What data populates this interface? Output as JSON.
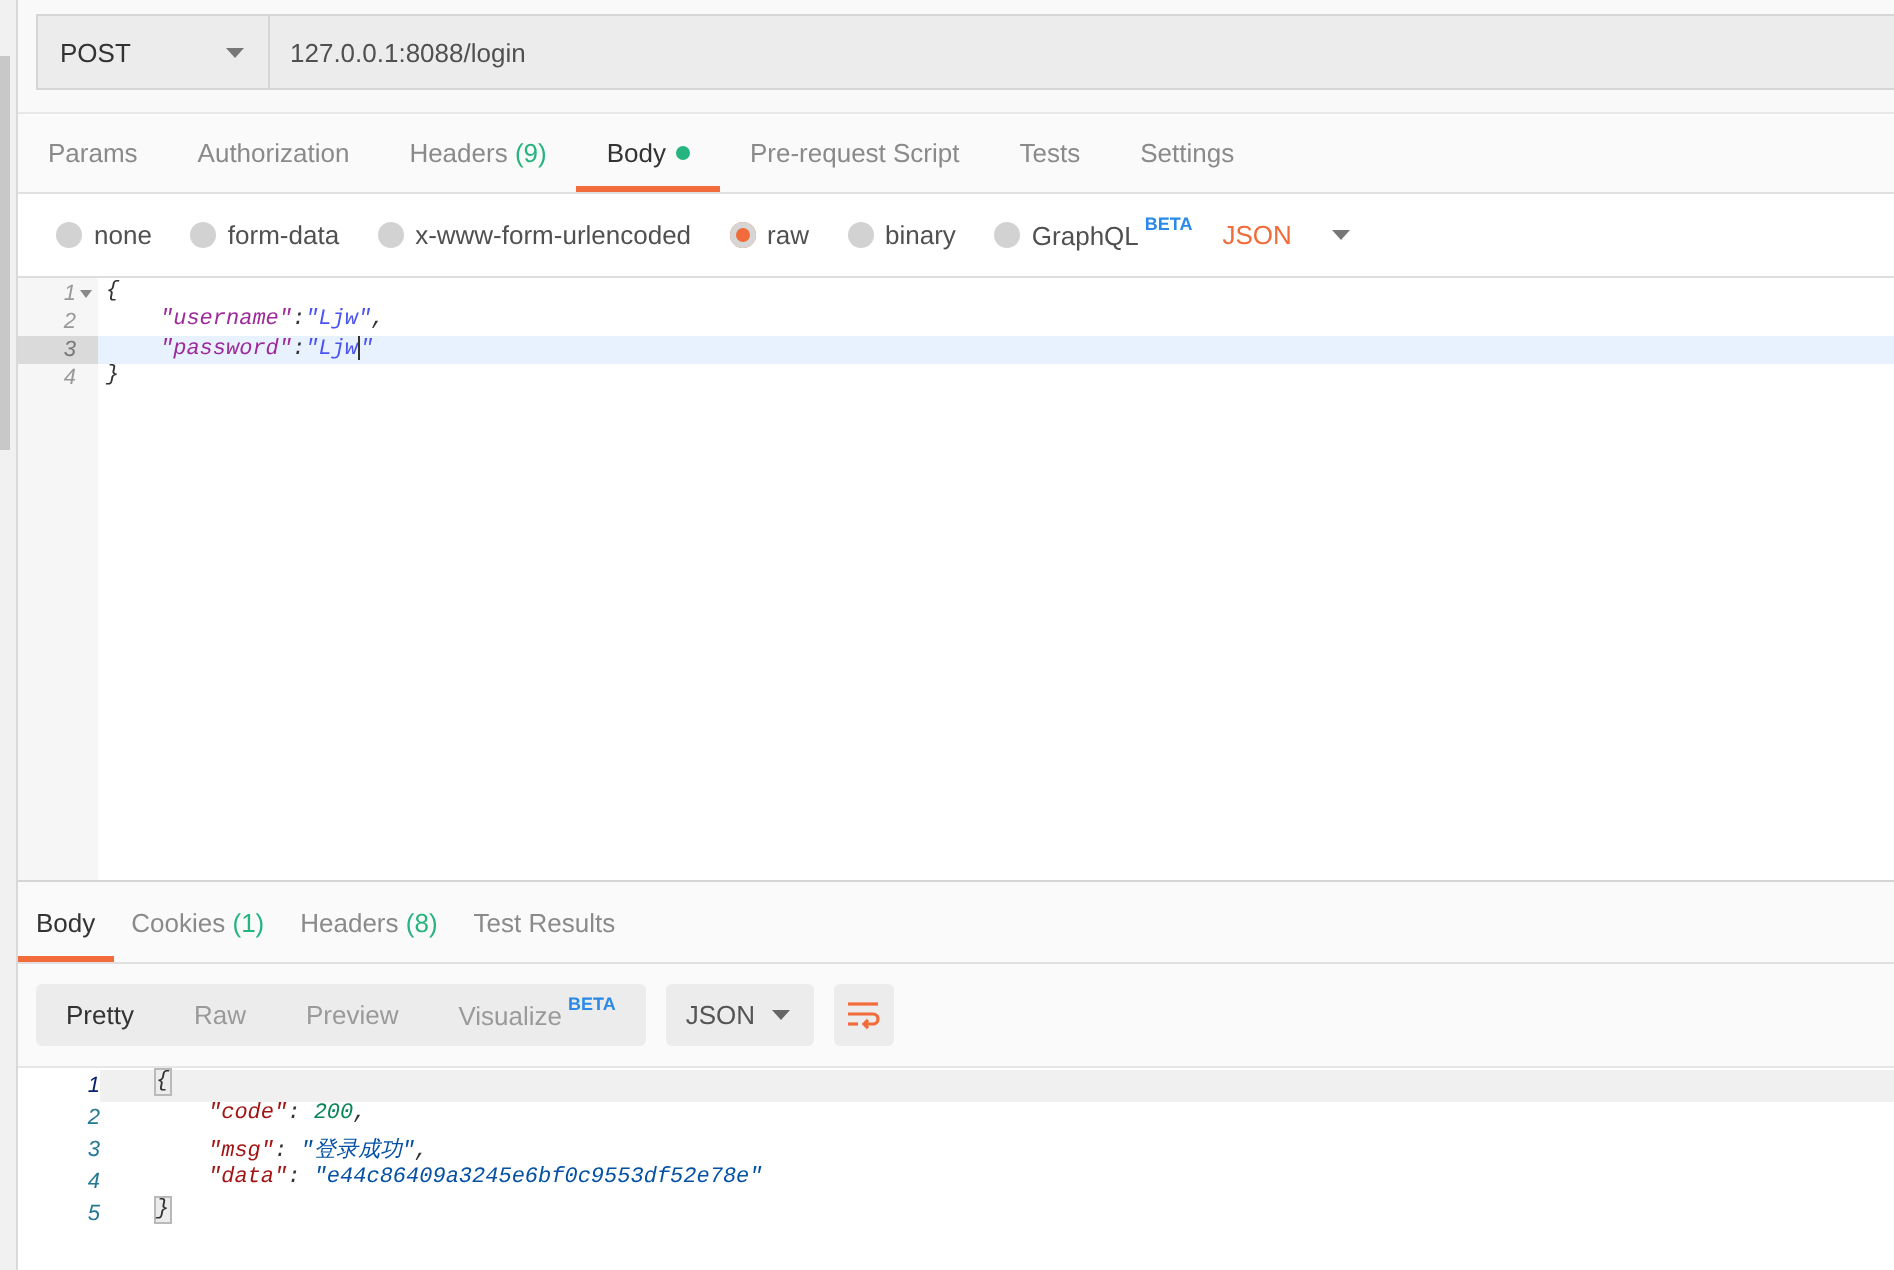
{
  "request": {
    "method": "POST",
    "url": "127.0.0.1:8088/login"
  },
  "request_tabs": [
    {
      "label": "Params",
      "selected": false,
      "dot": false
    },
    {
      "label": "Authorization",
      "selected": false,
      "dot": false
    },
    {
      "label": "Headers",
      "count": "(9)",
      "selected": false,
      "dot": false
    },
    {
      "label": "Body",
      "selected": true,
      "dot": true
    },
    {
      "label": "Pre-request Script",
      "selected": false,
      "dot": false
    },
    {
      "label": "Tests",
      "selected": false,
      "dot": false
    },
    {
      "label": "Settings",
      "selected": false,
      "dot": false
    }
  ],
  "body_types": [
    {
      "label": "none",
      "selected": false
    },
    {
      "label": "form-data",
      "selected": false
    },
    {
      "label": "x-www-form-urlencoded",
      "selected": false
    },
    {
      "label": "raw",
      "selected": true
    },
    {
      "label": "binary",
      "selected": false
    },
    {
      "label": "GraphQL",
      "badge": "BETA",
      "selected": false
    }
  ],
  "body_format": "JSON",
  "editor": {
    "lines": [
      {
        "number": "1",
        "foldable": true,
        "active": false,
        "tokens": [
          {
            "kind": "punct",
            "text": "{"
          }
        ],
        "children": [
          {
            "number": "2",
            "foldable": false,
            "active": false,
            "tokens": [
              {
                "kind": "key",
                "text": "\"username\""
              },
              {
                "kind": "punct",
                "text": ":"
              },
              {
                "kind": "string",
                "text": "\"Ljw\""
              },
              {
                "kind": "punct",
                "text": ","
              }
            ]
          },
          {
            "number": "3",
            "foldable": false,
            "active": true,
            "tokens": [
              {
                "kind": "key",
                "text": "\"password\""
              },
              {
                "kind": "punct",
                "text": ":"
              },
              {
                "kind": "string",
                "text": "\"Ljw"
              },
              {
                "kind": "caret"
              },
              {
                "kind": "string",
                "text": "\""
              }
            ]
          }
        ]
      },
      {
        "number": "4",
        "foldable": false,
        "active": false,
        "tokens": [
          {
            "kind": "punct",
            "text": "}"
          }
        ]
      }
    ]
  },
  "response": {
    "tabs": [
      {
        "label": "Body",
        "selected": true
      },
      {
        "label": "Cookies",
        "count": "(1)",
        "selected": false
      },
      {
        "label": "Headers",
        "count": "(8)",
        "selected": false
      },
      {
        "label": "Test Results",
        "selected": false
      }
    ],
    "view_modes": [
      {
        "label": "Pretty",
        "selected": true
      },
      {
        "label": "Raw",
        "selected": false
      },
      {
        "label": "Preview",
        "selected": false
      },
      {
        "label": "Visualize",
        "badge": "BETA",
        "selected": false
      }
    ],
    "format": "JSON",
    "wrap_enabled": true,
    "lines": [
      {
        "number": "1",
        "active": true,
        "tokens": [
          {
            "kind": "bracket_match",
            "text": "{"
          }
        ],
        "children": [
          {
            "number": "2",
            "active": false,
            "tokens": [
              {
                "kind": "key",
                "text": "\"code\""
              },
              {
                "kind": "punct",
                "text": ": "
              },
              {
                "kind": "number",
                "text": "200"
              },
              {
                "kind": "punct",
                "text": ","
              }
            ]
          },
          {
            "number": "3",
            "active": false,
            "tokens": [
              {
                "kind": "key",
                "text": "\"msg\""
              },
              {
                "kind": "punct",
                "text": ": "
              },
              {
                "kind": "string",
                "text": "\"登录成功\""
              },
              {
                "kind": "punct",
                "text": ","
              }
            ]
          },
          {
            "number": "4",
            "active": false,
            "tokens": [
              {
                "kind": "key",
                "text": "\"data\""
              },
              {
                "kind": "punct",
                "text": ": "
              },
              {
                "kind": "string",
                "text": "\"e44c86409a3245e6bf0c9553df52e78e\""
              }
            ]
          }
        ]
      },
      {
        "number": "5",
        "active": false,
        "tokens": [
          {
            "kind": "bracket_match",
            "text": "}"
          }
        ]
      }
    ]
  }
}
